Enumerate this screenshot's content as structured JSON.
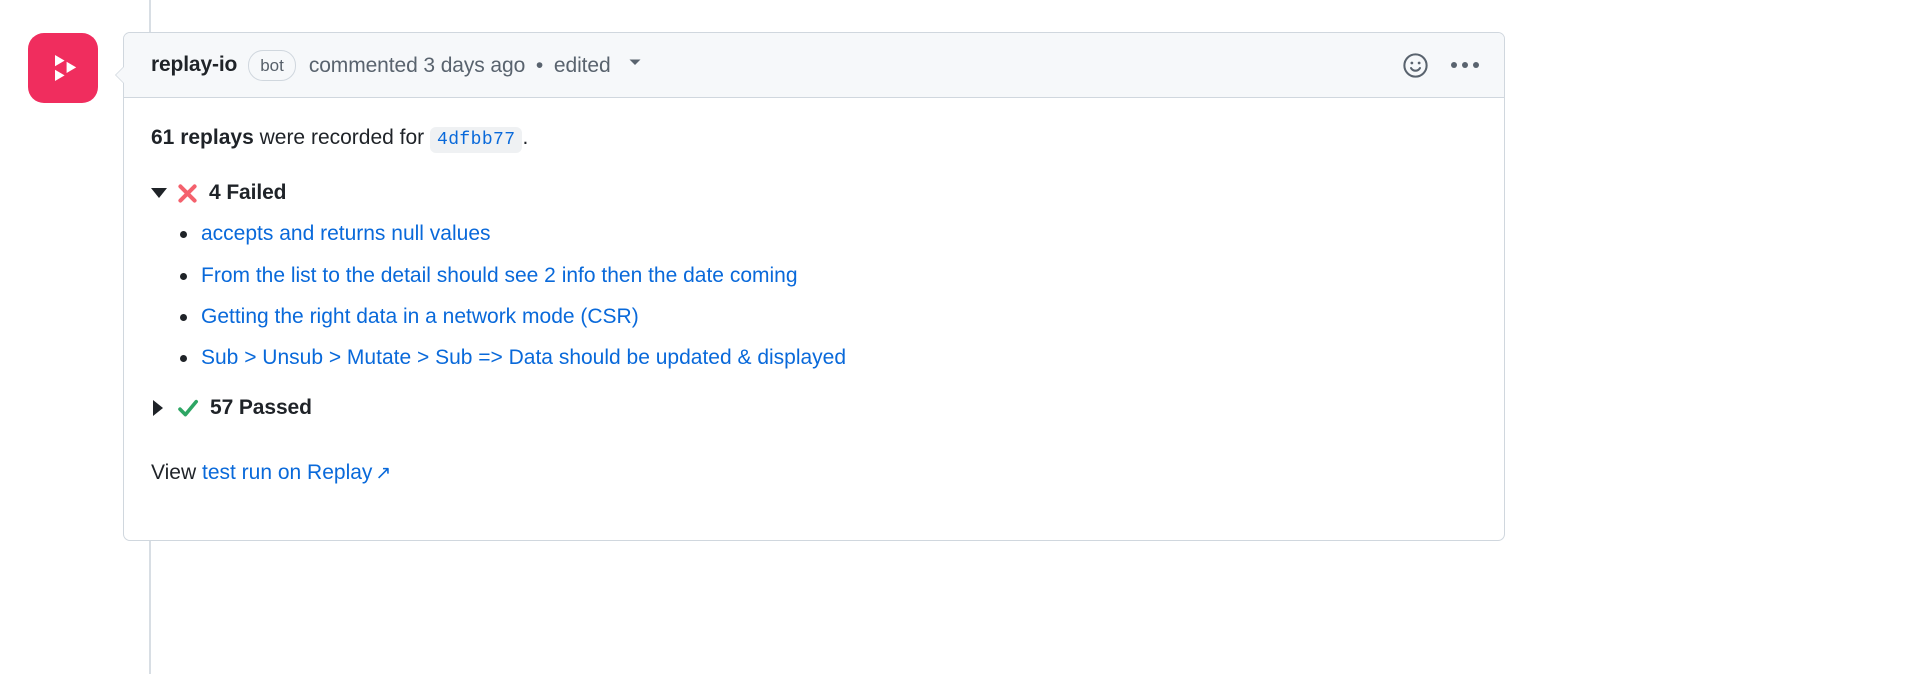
{
  "timeline": {
    "avatar": {
      "icon": "replay-logo-icon",
      "alt": "replay-io",
      "background": "#f02d5e"
    }
  },
  "comment": {
    "header": {
      "author": "replay-io",
      "badge": "bot",
      "commented_text": "commented",
      "timestamp": "3 days ago",
      "separator": "•",
      "edited_label": "edited",
      "caret_icon": "chevron-down-icon",
      "reaction_icon": "smiley-face-icon",
      "menu_icon": "kebab-menu-icon"
    },
    "body": {
      "summary": {
        "count": "61 replays",
        "text_middle": "were recorded for",
        "commit_hash": "4dfbb77",
        "trailing": "."
      },
      "sections": [
        {
          "id": "failed",
          "expanded": true,
          "disclosure_icon": "triangle-down-icon",
          "status_icon": "cross-mark-icon",
          "status_color": "#f4616d",
          "label": "4 Failed",
          "items": [
            "accepts and returns null values",
            "From the list to the detail should see 2 info then the date coming",
            "Getting the right data in a network mode (CSR)",
            "Sub > Unsub > Mutate > Sub => Data should be updated & displayed"
          ]
        },
        {
          "id": "passed",
          "expanded": false,
          "disclosure_icon": "triangle-right-icon",
          "status_icon": "check-mark-icon",
          "status_color": "#2ea664",
          "label": "57 Passed",
          "items": []
        }
      ],
      "footer": {
        "prefix": "View",
        "link_text": "test run on Replay",
        "external_icon": "↗"
      }
    }
  },
  "colors": {
    "link": "#0969da",
    "brand": "#f02d5e",
    "border": "#d0d7de",
    "header_bg": "#f6f8fa",
    "muted_text": "#59636e"
  }
}
